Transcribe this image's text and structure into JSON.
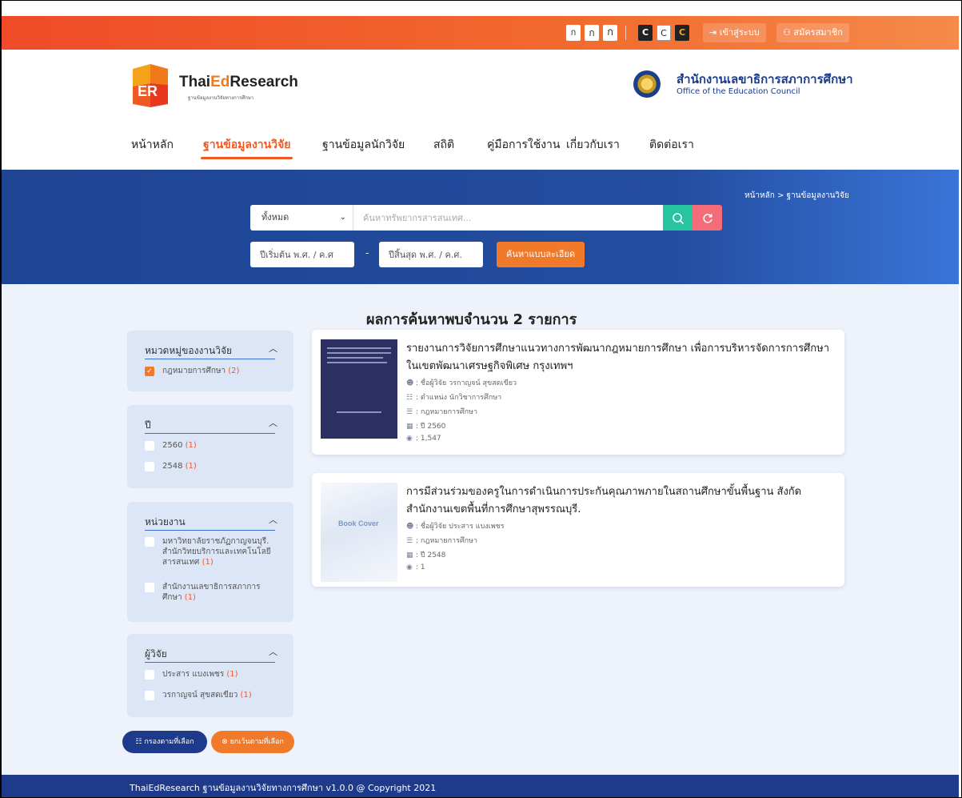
{
  "topbar": {
    "font_small": "ก",
    "font_medium": "ก",
    "font_large": "ก",
    "contrast_dark": "C",
    "contrast_light": "C",
    "contrast_yellow": "C",
    "login": "เข้าสู่ระบบ",
    "register": "สมัครสมาชิก",
    "login_icon": "login-icon",
    "register_icon": "user-icon"
  },
  "header": {
    "logo_title_1": "Thai",
    "logo_title_2": "Ed",
    "logo_title_3": "Research",
    "logo_subtitle": "ฐานข้อมูลงานวิจัยทางการศึกษา",
    "org_thai": "สำนักงานเลขาธิการสภาการศึกษา",
    "org_english": "Office of the Education Council"
  },
  "nav": {
    "home": "หน้าหลัก",
    "research_db": "ฐานข้อมูลงานวิจัย",
    "researcher_db": "ฐานข้อมูลนักวิจัย",
    "stats": "สถิติ",
    "manual": "คู่มือการใช้งาน",
    "about": "เกี่ยวกับเรา",
    "contact": "ติดต่อเรา"
  },
  "search": {
    "breadcrumb": "หน้าหลัก > ฐานข้อมูลงานวิจัย",
    "category_selected": "ทั้งหมด",
    "placeholder": "ค้นหาทรัพยากรสารสนเทศ...",
    "year_start_placeholder": "ปีเริ่มต้น พ.ศ. / ค.ศ",
    "year_end_placeholder": "ปีสิ้นสุด พ.ศ. / ค.ศ.",
    "year_dash": "-",
    "advanced": "ค้นหาแบบละเอียด",
    "search_icon": "search-icon",
    "reset_icon": "refresh-icon"
  },
  "results": {
    "summary": "ผลการค้นหาพบจำนวน 2 รายการ",
    "items": [
      {
        "title": "รายงานการวิจัยการศึกษาแนวทางการพัฒนากฎหมายการศึกษา เพื่อการบริหารจัดการการศึกษาในเขตพัฒนาเศรษฐกิจพิเศษ กรุงเทพฯ",
        "researcher": ": ชื่อผู้วิจัย วรกาญจน์ สุขสดเขียว",
        "position": ": ตำแหน่ง นักวิชาการศึกษา",
        "category": ": กฎหมายการศึกษา",
        "year": ": ปี 2560",
        "views": ": 1,547"
      },
      {
        "title": "การมีส่วนร่วมของครูในการดำเนินการประกันคุณภาพภายในสถานศึกษาขั้นพื้นฐาน สังกัดสำนักงานเขตพื้นที่การศึกษาสุพรรณบุรี.",
        "researcher": ": ชื่อผู้วิจัย ประสาร แบงเพชร",
        "category": ": กฎหมายการศึกษา",
        "year": ": ปี 2548",
        "views": ": 1",
        "cover_text": "Book Cover"
      }
    ]
  },
  "facets": [
    {
      "title": "หมวดหมู่ของงานวิจัย",
      "options": [
        {
          "label": "กฎหมายการศึกษา",
          "count": "(2)",
          "checked": true
        }
      ]
    },
    {
      "title": "ปี",
      "options": [
        {
          "label": "2560",
          "count": "(1)",
          "checked": false
        },
        {
          "label": "2548",
          "count": "(1)",
          "checked": false
        }
      ]
    },
    {
      "title": "หน่วยงาน",
      "options": [
        {
          "label": "มหาวิทยาลัยราชภัฏกาญจนบุรี. สำนักวิทยบริการและเทคโนโลยีสารสนเทศ",
          "count": "(1)",
          "checked": false
        },
        {
          "label": "สำนักงานเลขาธิการสภาการศึกษา",
          "count": "(1)",
          "checked": false
        }
      ]
    },
    {
      "title": "ผู้วิจัย",
      "options": [
        {
          "label": "ประสาร แบงเพชร",
          "count": "(1)",
          "checked": false
        },
        {
          "label": "วรกาญจน์ สุขสดเขียว",
          "count": "(1)",
          "checked": false
        }
      ]
    }
  ],
  "filter_buttons": {
    "filter": "กรองตามที่เลือก",
    "cancel": "ยกเว้นตามที่เลือก"
  },
  "footer": {
    "text": "ThaiEdResearch ฐานข้อมูลงานวิจัยทางการศึกษา v1.0.0 @ Copyright 2021"
  },
  "colors": {
    "brand_orange": "#ef5a24",
    "brand_navy": "#1e3a8a",
    "teal": "#27c4a0",
    "pink": "#f46b7a"
  }
}
